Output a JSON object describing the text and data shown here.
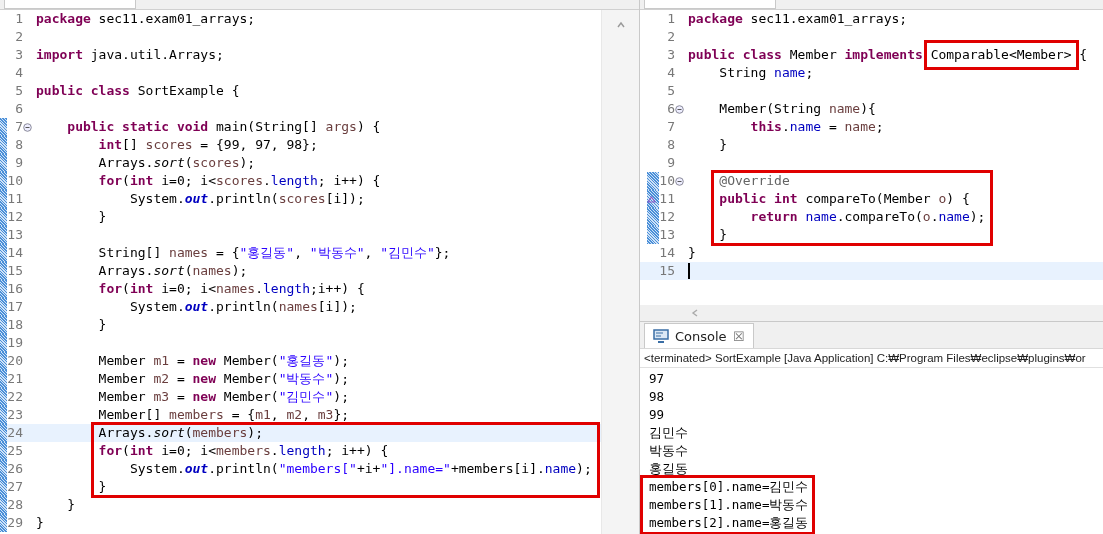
{
  "left_editor": {
    "blocks": [
      {
        "framed": false,
        "lines": [
          {
            "number": "1",
            "changed": false,
            "current": false,
            "tokens": [
              {
                "text": "package",
                "kind": "kw"
              },
              {
                "text": " sec11.exam01_arrays;",
                "kind": "plain"
              }
            ]
          },
          {
            "number": "2",
            "changed": false,
            "current": false
          },
          {
            "number": "3",
            "changed": false,
            "current": false,
            "tokens": [
              {
                "text": "import",
                "kind": "kw"
              },
              {
                "text": " java.util.Arrays;",
                "kind": "plain"
              }
            ]
          },
          {
            "number": "4",
            "changed": false,
            "current": false
          },
          {
            "number": "5",
            "changed": false,
            "current": false,
            "tokens": [
              {
                "text": "public class",
                "kind": "kw"
              },
              {
                "text": " SortExample {",
                "kind": "plain"
              }
            ]
          },
          {
            "number": "6",
            "changed": false,
            "current": false
          },
          {
            "number": "7",
            "changed": true,
            "current": false,
            "kind": "fold",
            "tokens": [
              {
                "text": "    public static void",
                "kind": "kw"
              },
              {
                "text": " main(String[] ",
                "kind": "plain"
              },
              {
                "text": "args",
                "kind": "local"
              },
              {
                "text": ") {",
                "kind": "plain"
              }
            ]
          },
          {
            "number": "8",
            "changed": true,
            "current": false,
            "tokens": [
              {
                "text": "        int",
                "kind": "kw"
              },
              {
                "text": "[] ",
                "kind": "plain"
              },
              {
                "text": "scores",
                "kind": "local"
              },
              {
                "text": " = {99, 97, 98};",
                "kind": "plain"
              }
            ]
          },
          {
            "number": "9",
            "changed": true,
            "current": false,
            "tokens": [
              {
                "text": "        Arrays.",
                "kind": "plain"
              },
              {
                "text": "sort",
                "kind": "static_method"
              },
              {
                "text": "(",
                "kind": "plain"
              },
              {
                "text": "scores",
                "kind": "local"
              },
              {
                "text": ");",
                "kind": "plain"
              }
            ]
          },
          {
            "number": "10",
            "changed": true,
            "current": false,
            "tokens": [
              {
                "text": "        for",
                "kind": "kw"
              },
              {
                "text": "(",
                "kind": "plain"
              },
              {
                "text": "int",
                "kind": "kw"
              },
              {
                "text": " i=0; i<",
                "kind": "plain"
              },
              {
                "text": "scores",
                "kind": "local"
              },
              {
                "text": ".",
                "kind": "plain"
              },
              {
                "text": "length",
                "kind": "field"
              },
              {
                "text": "; i++) {",
                "kind": "plain"
              }
            ]
          },
          {
            "number": "11",
            "changed": true,
            "current": false,
            "tokens": [
              {
                "text": "            System.",
                "kind": "plain"
              },
              {
                "text": "out",
                "kind": "static_field"
              },
              {
                "text": ".println(",
                "kind": "plain"
              },
              {
                "text": "scores",
                "kind": "local"
              },
              {
                "text": "[i]);",
                "kind": "plain"
              }
            ]
          },
          {
            "number": "12",
            "changed": true,
            "current": false,
            "tokens": [
              {
                "text": "        }",
                "kind": "plain"
              }
            ]
          },
          {
            "number": "13",
            "changed": true,
            "current": false
          },
          {
            "number": "14",
            "changed": true,
            "current": false,
            "tokens": [
              {
                "text": "        String[] ",
                "kind": "plain"
              },
              {
                "text": "names",
                "kind": "local"
              },
              {
                "text": " = {",
                "kind": "plain"
              },
              {
                "text": "\"홍길동\"",
                "kind": "str"
              },
              {
                "text": ", ",
                "kind": "plain"
              },
              {
                "text": "\"박동수\"",
                "kind": "str"
              },
              {
                "text": ", ",
                "kind": "plain"
              },
              {
                "text": "\"김민수\"",
                "kind": "str"
              },
              {
                "text": "};",
                "kind": "plain"
              }
            ]
          },
          {
            "number": "15",
            "changed": true,
            "current": false,
            "tokens": [
              {
                "text": "        Arrays.",
                "kind": "plain"
              },
              {
                "text": "sort",
                "kind": "static_method"
              },
              {
                "text": "(",
                "kind": "plain"
              },
              {
                "text": "names",
                "kind": "local"
              },
              {
                "text": ");",
                "kind": "plain"
              }
            ]
          },
          {
            "number": "16",
            "changed": true,
            "current": false,
            "tokens": [
              {
                "text": "        for",
                "kind": "kw"
              },
              {
                "text": "(",
                "kind": "plain"
              },
              {
                "text": "int",
                "kind": "kw"
              },
              {
                "text": " i=0; i<",
                "kind": "plain"
              },
              {
                "text": "names",
                "kind": "local"
              },
              {
                "text": ".",
                "kind": "plain"
              },
              {
                "text": "length",
                "kind": "field"
              },
              {
                "text": ";i++) {",
                "kind": "plain"
              }
            ]
          },
          {
            "number": "17",
            "changed": true,
            "current": false,
            "tokens": [
              {
                "text": "            System.",
                "kind": "plain"
              },
              {
                "text": "out",
                "kind": "static_field"
              },
              {
                "text": ".println(",
                "kind": "plain"
              },
              {
                "text": "names",
                "kind": "local"
              },
              {
                "text": "[i]);",
                "kind": "plain"
              }
            ]
          },
          {
            "number": "18",
            "changed": true,
            "current": false,
            "tokens": [
              {
                "text": "        }",
                "kind": "plain"
              }
            ]
          },
          {
            "number": "19",
            "changed": true,
            "current": false
          },
          {
            "number": "20",
            "changed": true,
            "current": false,
            "tokens": [
              {
                "text": "        Member ",
                "kind": "plain"
              },
              {
                "text": "m1",
                "kind": "local"
              },
              {
                "text": " = ",
                "kind": "plain"
              },
              {
                "text": "new",
                "kind": "kw"
              },
              {
                "text": " Member(",
                "kind": "plain"
              },
              {
                "text": "\"홍길동\"",
                "kind": "str"
              },
              {
                "text": ");",
                "kind": "plain"
              }
            ]
          },
          {
            "number": "21",
            "changed": true,
            "current": false,
            "tokens": [
              {
                "text": "        Member ",
                "kind": "plain"
              },
              {
                "text": "m2",
                "kind": "local"
              },
              {
                "text": " = ",
                "kind": "plain"
              },
              {
                "text": "new",
                "kind": "kw"
              },
              {
                "text": " Member(",
                "kind": "plain"
              },
              {
                "text": "\"박동수\"",
                "kind": "str"
              },
              {
                "text": ");",
                "kind": "plain"
              }
            ]
          },
          {
            "number": "22",
            "changed": true,
            "current": false,
            "tokens": [
              {
                "text": "        Member ",
                "kind": "plain"
              },
              {
                "text": "m3",
                "kind": "local"
              },
              {
                "text": " = ",
                "kind": "plain"
              },
              {
                "text": "new",
                "kind": "kw"
              },
              {
                "text": " Member(",
                "kind": "plain"
              },
              {
                "text": "\"김민수\"",
                "kind": "str"
              },
              {
                "text": ");",
                "kind": "plain"
              }
            ]
          },
          {
            "number": "23",
            "changed": true,
            "current": false,
            "tokens": [
              {
                "text": "        Member[] ",
                "kind": "plain"
              },
              {
                "text": "members",
                "kind": "local"
              },
              {
                "text": " = {",
                "kind": "plain"
              },
              {
                "text": "m1",
                "kind": "local"
              },
              {
                "text": ", ",
                "kind": "plain"
              },
              {
                "text": "m2",
                "kind": "local"
              },
              {
                "text": ", ",
                "kind": "plain"
              },
              {
                "text": "m3",
                "kind": "local"
              },
              {
                "text": "};",
                "kind": "plain"
              }
            ]
          }
        ]
      },
      {
        "framed": true,
        "lines": [
          {
            "number": "24",
            "changed": true,
            "current": true,
            "tokens": [
              {
                "text": "        Arrays.",
                "kind": "plain"
              },
              {
                "text": "sort",
                "kind": "static_method"
              },
              {
                "text": "(",
                "kind": "plain"
              },
              {
                "text": "members",
                "kind": "local"
              },
              {
                "text": ");",
                "kind": "plain"
              }
            ]
          },
          {
            "number": "25",
            "changed": true,
            "current": false,
            "tokens": [
              {
                "text": "        for",
                "kind": "kw"
              },
              {
                "text": "(",
                "kind": "plain"
              },
              {
                "text": "int",
                "kind": "kw"
              },
              {
                "text": " i=0; i<",
                "kind": "plain"
              },
              {
                "text": "members",
                "kind": "local"
              },
              {
                "text": ".",
                "kind": "plain"
              },
              {
                "text": "length",
                "kind": "field"
              },
              {
                "text": "; i++) {",
                "kind": "plain"
              }
            ]
          },
          {
            "number": "26",
            "changed": true,
            "current": false,
            "tokens": [
              {
                "text": "            System.",
                "kind": "plain"
              },
              {
                "text": "out",
                "kind": "static_field"
              },
              {
                "text": ".println(",
                "kind": "plain"
              },
              {
                "text": "\"members[\"",
                "kind": "str"
              },
              {
                "text": "+i+",
                "kind": "plain"
              },
              {
                "text": "\"].name=\"",
                "kind": "str"
              },
              {
                "text": "+members[i].",
                "kind": "plain"
              },
              {
                "text": "name",
                "kind": "field"
              },
              {
                "text": ");",
                "kind": "plain"
              }
            ]
          },
          {
            "number": "27",
            "changed": true,
            "current": false,
            "tokens": [
              {
                "text": "        }",
                "kind": "plain"
              }
            ]
          }
        ]
      },
      {
        "framed": false,
        "lines": [
          {
            "number": "28",
            "changed": true,
            "current": false,
            "tokens": [
              {
                "text": "    }",
                "kind": "plain"
              }
            ]
          },
          {
            "number": "29",
            "changed": true,
            "current": false,
            "tokens": [
              {
                "text": "}",
                "kind": "plain"
              }
            ]
          }
        ]
      }
    ]
  },
  "right_editor": {
    "blocks": [
      {
        "framed": false,
        "lines": [
          {
            "number": "1",
            "changed": false,
            "current": false,
            "tokens": [
              {
                "text": "package",
                "kind": "kw"
              },
              {
                "text": " sec11.exam01_arrays;",
                "kind": "plain"
              }
            ]
          },
          {
            "number": "2",
            "changed": false,
            "current": false
          },
          {
            "number": "3",
            "changed": false,
            "current": false,
            "tokens": [
              {
                "text": "public class",
                "kind": "kw"
              },
              {
                "text": " Member ",
                "kind": "plain"
              },
              {
                "text": "implements ",
                "kind": "kw"
              },
              {
                "text": "Comparable<Member>",
                "kind": "boxed"
              },
              {
                "text": " {",
                "kind": "plain"
              }
            ]
          },
          {
            "number": "4",
            "changed": false,
            "current": false,
            "tokens": [
              {
                "text": "    String ",
                "kind": "plain"
              },
              {
                "text": "name",
                "kind": "field"
              },
              {
                "text": ";",
                "kind": "plain"
              }
            ]
          },
          {
            "number": "5",
            "changed": false,
            "current": false
          },
          {
            "number": "6",
            "changed": false,
            "current": false,
            "kind": "fold",
            "tokens": [
              {
                "text": "    Member(String ",
                "kind": "plain"
              },
              {
                "text": "name",
                "kind": "local"
              },
              {
                "text": "){",
                "kind": "plain"
              }
            ]
          },
          {
            "number": "7",
            "changed": false,
            "current": false,
            "tokens": [
              {
                "text": "        this",
                "kind": "kw"
              },
              {
                "text": ".",
                "kind": "plain"
              },
              {
                "text": "name",
                "kind": "field"
              },
              {
                "text": " = ",
                "kind": "plain"
              },
              {
                "text": "name",
                "kind": "local"
              },
              {
                "text": ";",
                "kind": "plain"
              }
            ]
          },
          {
            "number": "8",
            "changed": false,
            "current": false,
            "tokens": [
              {
                "text": "    }",
                "kind": "plain"
              }
            ]
          },
          {
            "number": "9",
            "changed": false,
            "current": false
          }
        ]
      },
      {
        "framed": true,
        "lines": [
          {
            "number": "10",
            "changed": true,
            "current": false,
            "kind": "fold",
            "tokens": [
              {
                "text": "    @Override",
                "kind": "annot"
              }
            ]
          },
          {
            "number": "11",
            "changed": true,
            "current": false,
            "kind": "override",
            "tokens": [
              {
                "text": "    public int",
                "kind": "kw"
              },
              {
                "text": " compareTo(Member ",
                "kind": "plain"
              },
              {
                "text": "o",
                "kind": "local"
              },
              {
                "text": ") {",
                "kind": "plain"
              }
            ]
          },
          {
            "number": "12",
            "changed": true,
            "current": false,
            "tokens": [
              {
                "text": "        return ",
                "kind": "kw"
              },
              {
                "text": "name",
                "kind": "field"
              },
              {
                "text": ".compareTo(",
                "kind": "plain"
              },
              {
                "text": "o",
                "kind": "local"
              },
              {
                "text": ".",
                "kind": "plain"
              },
              {
                "text": "name",
                "kind": "field"
              },
              {
                "text": ");",
                "kind": "plain"
              }
            ]
          },
          {
            "number": "13",
            "changed": true,
            "current": false,
            "tokens": [
              {
                "text": "    }",
                "kind": "plain"
              }
            ]
          }
        ]
      },
      {
        "framed": false,
        "lines": [
          {
            "number": "14",
            "changed": false,
            "current": false,
            "tokens": [
              {
                "text": "}",
                "kind": "plain"
              }
            ]
          },
          {
            "number": "15",
            "changed": false,
            "current": true
          }
        ]
      }
    ]
  },
  "console": {
    "tab": {
      "label": "Console",
      "close": "☒"
    },
    "status": "<terminated> SortExample [Java Application] C:₩Program Files₩eclipse₩plugins₩or",
    "blocks": [
      {
        "framed": false,
        "lines": [
          "97",
          "98",
          "99",
          "김민수",
          "박동수",
          "홍길동"
        ]
      },
      {
        "framed": true,
        "lines": [
          "members[0].name=김민수",
          "members[1].name=박동수",
          "members[2].name=홍길동"
        ]
      }
    ]
  }
}
